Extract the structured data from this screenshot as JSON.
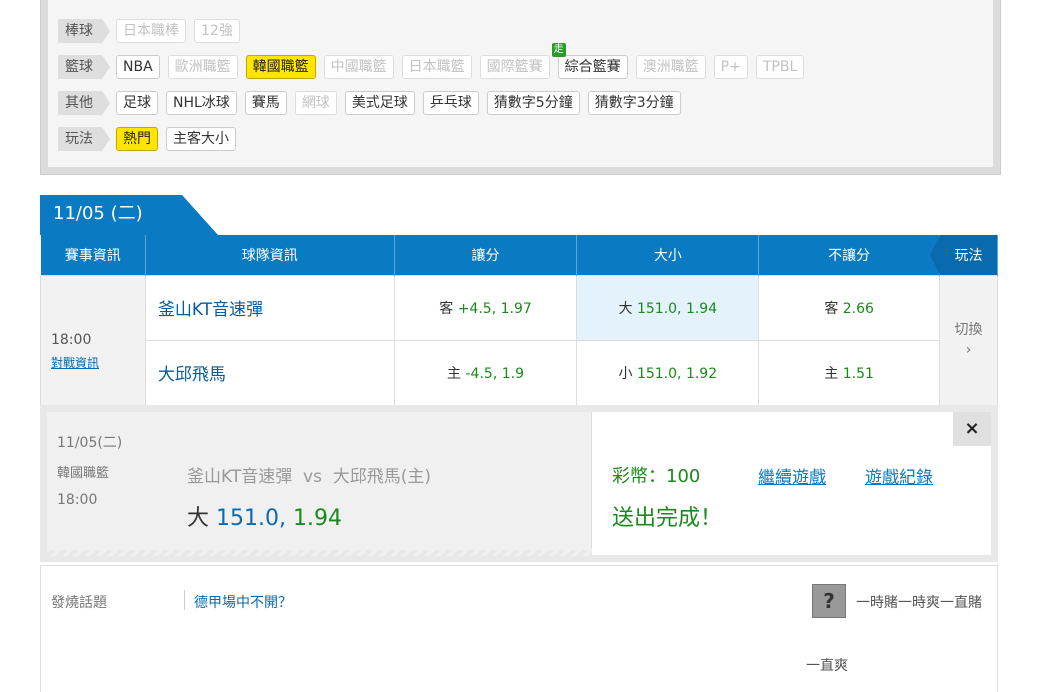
{
  "filters": [
    {
      "category": "棒球",
      "items": [
        {
          "label": "日本職棒",
          "state": "disabled"
        },
        {
          "label": "12強",
          "state": "disabled"
        }
      ]
    },
    {
      "category": "籃球",
      "items": [
        {
          "label": "NBA",
          "state": "normal"
        },
        {
          "label": "歐洲職籃",
          "state": "disabled"
        },
        {
          "label": "韓國職籃",
          "state": "active"
        },
        {
          "label": "中國職籃",
          "state": "disabled"
        },
        {
          "label": "日本職籃",
          "state": "disabled"
        },
        {
          "label": "國際籃賽",
          "state": "disabled"
        },
        {
          "label": "綜合籃賽",
          "state": "normal",
          "badge": "走"
        },
        {
          "label": "澳洲職籃",
          "state": "disabled"
        },
        {
          "label": "P+",
          "state": "disabled"
        },
        {
          "label": "TPBL",
          "state": "disabled"
        }
      ]
    },
    {
      "category": "其他",
      "items": [
        {
          "label": "足球",
          "state": "normal"
        },
        {
          "label": "NHL冰球",
          "state": "normal"
        },
        {
          "label": "賽馬",
          "state": "normal"
        },
        {
          "label": "網球",
          "state": "disabled"
        },
        {
          "label": "美式足球",
          "state": "normal"
        },
        {
          "label": "乒乓球",
          "state": "normal"
        },
        {
          "label": "猜數字5分鐘",
          "state": "normal"
        },
        {
          "label": "猜數字3分鐘",
          "state": "normal"
        }
      ]
    },
    {
      "category": "玩法",
      "items": [
        {
          "label": "熱門",
          "state": "active"
        },
        {
          "label": "主客大小",
          "state": "normal"
        }
      ]
    }
  ],
  "date_tab": "11/05 (二)",
  "table": {
    "headers": [
      "賽事資訊",
      "球隊資訊",
      "讓分",
      "大小",
      "不讓分",
      "玩法"
    ],
    "time": "18:00",
    "matchup_link": "對戰資訊",
    "switch_label": "切換",
    "switch_arrow": "›",
    "rows": [
      {
        "team": "釜山KT音速彈",
        "spread_side": "客",
        "spread_line": "+4.5,",
        "spread_odds": "1.97",
        "total_side": "大",
        "total_line": "151.0,",
        "total_odds": "1.94",
        "ml_side": "客",
        "ml_odds": "2.66"
      },
      {
        "team": "大邱飛馬",
        "spread_side": "主",
        "spread_line": "-4.5,",
        "spread_odds": "1.9",
        "total_side": "小",
        "total_line": "151.0,",
        "total_odds": "1.92",
        "ml_side": "主",
        "ml_odds": "1.51"
      }
    ]
  },
  "confirmation": {
    "date": "11/05(二)",
    "league": "韓國職籃",
    "time": "18:00",
    "matchup": "釜山KT音速彈  vs  大邱飛馬(主)",
    "pick_side": "大",
    "pick_line": "151.0,",
    "pick_odds": "1.94",
    "coins": "彩幣：100",
    "done": "送出完成！",
    "continue_link": "繼續遊戲",
    "record_link": "遊戲紀錄",
    "close": "×"
  },
  "bottom": {
    "hot_label": "發燒話題",
    "hot_topic": "德甲場中不開？",
    "nickname": "一時賭一時爽一直賭",
    "reply": "一直爽",
    "avatar_glyph": "?"
  },
  "colors": {
    "primary": "#0a7ac2",
    "odds_green": "#1a8a1a",
    "active_chip": "#ffe500"
  }
}
